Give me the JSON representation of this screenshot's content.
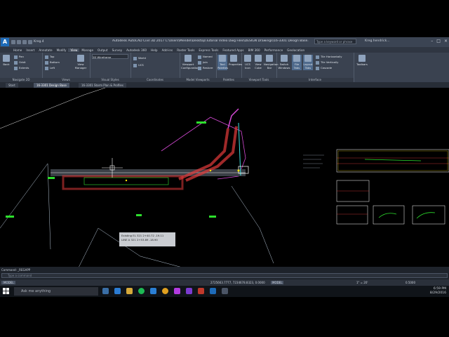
{
  "window": {
    "app_button": "A",
    "title": "Autodesk AutoCAD Civil 3D 2017   C:\\Users\\Mendel\\Desktop\\Tutorial Video Dwg Files\\DESIGN Drawings\\16-3301 Design Base.dwg [Data Shortcuts]",
    "search_placeholder": "Type a keyword or phrase",
    "user": "Kreg.hendrick...",
    "qat_label": "Kreg.4"
  },
  "ribbon_tabs": [
    "Home",
    "Insert",
    "Annotate",
    "Modify",
    "View",
    "Manage",
    "Output",
    "Survey",
    "Autodesk 360",
    "Help",
    "Add-ins",
    "Raster Tools",
    "Express Tools",
    "Featured Apps",
    "BIM 360",
    "Performance",
    "Geolocation"
  ],
  "active_tab": "View",
  "ribbon": {
    "navigate": {
      "label": "Navigate 2D",
      "back": "Back",
      "pan": "Pan",
      "orbit": "Orbit",
      "extents": "Extents"
    },
    "views": {
      "label": "Views",
      "top": "Top",
      "bottom": "Bottom",
      "left": "Left",
      "view_manager": "View Manager"
    },
    "visual_styles": {
      "label": "Visual Styles",
      "current": "2D Wireframe"
    },
    "coordinates": {
      "label": "Coordinates",
      "world": "World",
      "ucs": "UCS"
    },
    "model_viewports": {
      "label": "Model Viewports",
      "config": "Viewport Configuration",
      "named": "Named",
      "join": "Join",
      "restore": "Restore"
    },
    "palettes": {
      "label": "Palettes",
      "tool_palettes": "Tool Palettes",
      "properties": "Properties",
      "ucs_icon": "UCS Icon",
      "view_cube": "View Cube",
      "nav_bar": "Navigation Bar"
    },
    "viewport_tools": {
      "label": "Viewport Tools"
    },
    "interface": {
      "label": "Interface",
      "switch_windows": "Switch Windows",
      "file_tabs": "File Tabs",
      "layout_tabs": "Layout Tabs",
      "tile_horizontally": "Tile Horizontally",
      "tile_vertically": "Tile Vertically",
      "cascade": "Cascade",
      "toolbars": "Toolbars"
    }
  },
  "doc_tabs": [
    "Start",
    "16-3301 Design Base",
    "16-3301 Storm Plan & Profiles"
  ],
  "active_doc": "16-3301 Design Base",
  "canvas_popup": {
    "row1": "Existing EL   321   2+40.72   -19.11",
    "row2": "LINE A   321   2+53.89   -18.90"
  },
  "command": {
    "history": "Command: _REGAPP",
    "prompt": "Type a command"
  },
  "status": {
    "model": "MODEL",
    "coords": "2725663.7777, 7234678.8323, 0.0000",
    "mode": "MODEL",
    "scale": "1\" = 20'",
    "zoom": "0.5000"
  },
  "taskbar": {
    "search": "Ask me anything",
    "time": "6:59 PM",
    "date": "8/29/2016"
  },
  "colors": {
    "accent": "#1e6bb8",
    "ribbon_bg": "#3a4250",
    "canvas_bg": "#000000",
    "road": "#e23b3b",
    "magenta": "#d64ad6",
    "green": "#2de02d",
    "cyan": "#3ee0e0",
    "yellow": "#ffe600"
  }
}
